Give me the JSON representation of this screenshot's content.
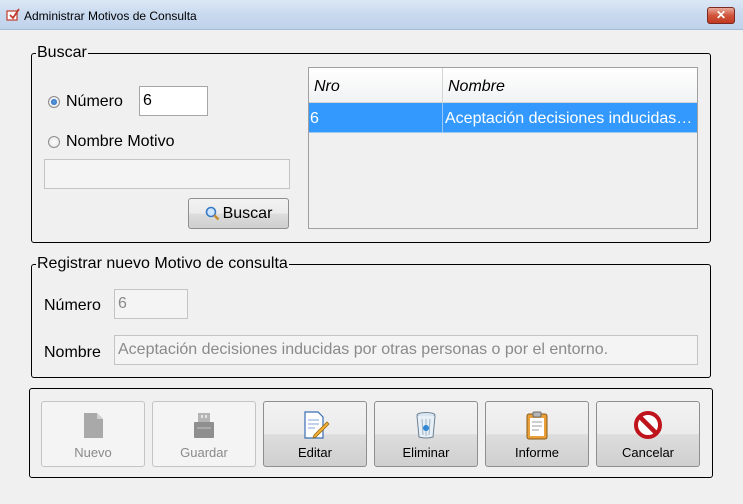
{
  "window": {
    "title": "Administrar Motivos de Consulta",
    "close_label": "✕"
  },
  "buscar": {
    "legend": "Buscar",
    "radio_numero": "Número",
    "radio_nombre": "Nombre Motivo",
    "numero_value": "6",
    "nombre_value": "",
    "button_label": "Buscar",
    "selected_radio": "numero"
  },
  "grid": {
    "columns": [
      "Nro",
      "Nombre"
    ],
    "rows": [
      {
        "nro": "6",
        "nombre": "Aceptación decisiones inducidas por otras personas o por el entorno."
      }
    ]
  },
  "registrar": {
    "legend": "Registrar nuevo Motivo de consulta",
    "numero_label": "Número",
    "numero_value": "6",
    "nombre_label": "Nombre",
    "nombre_value": "Aceptación decisiones inducidas por otras personas o por el entorno."
  },
  "toolbar": {
    "nuevo": "Nuevo",
    "guardar": "Guardar",
    "editar": "Editar",
    "eliminar": "Eliminar",
    "informe": "Informe",
    "cancelar": "Cancelar"
  },
  "colors": {
    "selection": "#3399ff",
    "close_red": "#c13a20"
  }
}
